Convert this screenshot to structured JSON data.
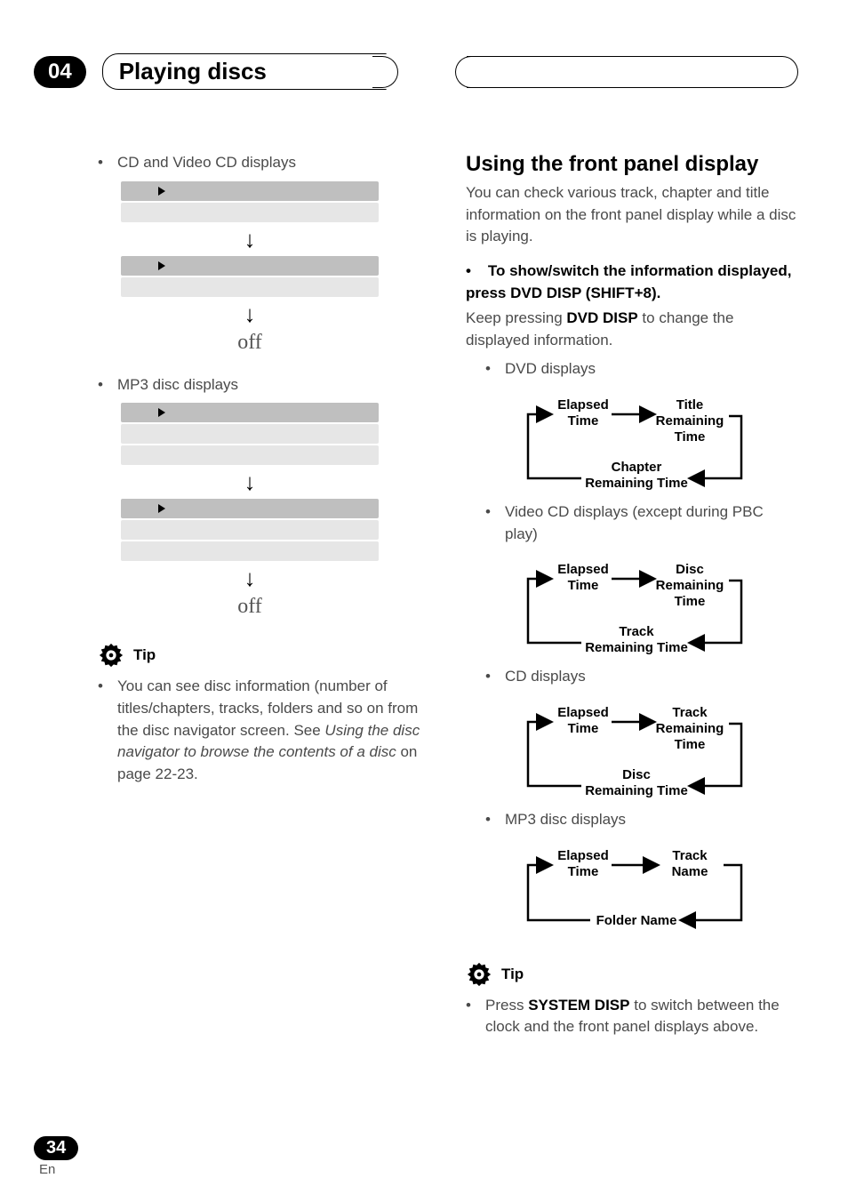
{
  "chapter": "04",
  "title": "Playing discs",
  "left": {
    "bullet_cd_vcd": "CD and Video CD displays",
    "off": "off",
    "bullet_mp3": "MP3 disc displays",
    "tip_label": "Tip",
    "tip_text_1": "You can see disc information (number of titles/chapters, tracks, folders and so on from the disc navigator screen. See ",
    "tip_text_italic": "Using the disc navigator to browse the contents of a disc",
    "tip_text_2": " on page 22-23."
  },
  "right": {
    "section": "Using the front panel display",
    "intro": "You can check various track, chapter and title information on the front panel display while a disc is playing.",
    "step_bold": "To show/switch the information displayed, press DVD DISP (SHIFT+8).",
    "step_body_1": "Keep pressing ",
    "step_body_bold": "DVD DISP",
    "step_body_2": " to change the displayed information.",
    "b_dvd": "DVD displays",
    "b_vcd": "Video CD displays (except during PBC play)",
    "b_cd": "CD displays",
    "b_mp3": "MP3 disc displays",
    "tip_label": "Tip",
    "tip2_1": "Press ",
    "tip2_bold": "SYSTEM DISP",
    "tip2_2": " to switch between the clock and the front panel displays above.",
    "cycles": {
      "dvd": {
        "a1": "Elapsed",
        "a2": "Time",
        "b1": "Title",
        "b2": "Remaining",
        "b3": "Time",
        "c1": "Chapter",
        "c2": "Remaining Time"
      },
      "vcd": {
        "a1": "Elapsed",
        "a2": "Time",
        "b1": "Disc",
        "b2": "Remaining",
        "b3": "Time",
        "c1": "Track",
        "c2": "Remaining Time"
      },
      "cd": {
        "a1": "Elapsed",
        "a2": "Time",
        "b1": "Track",
        "b2": "Remaining",
        "b3": "Time",
        "c1": "Disc",
        "c2": "Remaining Time"
      },
      "mp3": {
        "a1": "Elapsed",
        "a2": "Time",
        "b1": "Track",
        "b2": "Name",
        "c1": "Folder Name"
      }
    }
  },
  "page": "34",
  "lang": "En"
}
